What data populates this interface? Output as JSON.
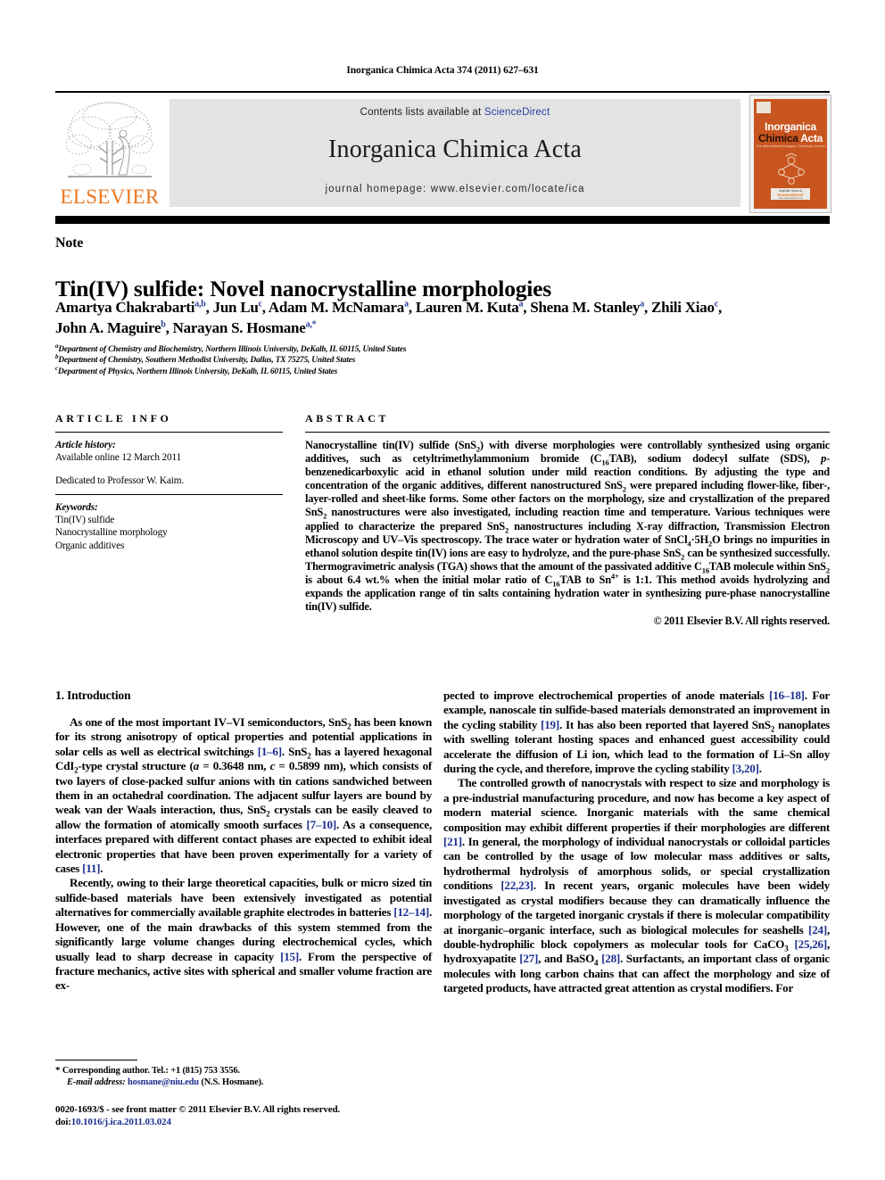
{
  "running_head": "Inorganica Chimica Acta 374 (2011) 627–631",
  "masthead": {
    "contents_prefix": "Contents lists available at ",
    "sciencedirect": "ScienceDirect",
    "journal_title": "Inorganica Chimica Acta",
    "homepage": "journal homepage: www.elsevier.com/locate/ica",
    "publisher_wordmark": "ELSEVIER",
    "cover": {
      "line1": "Inorganica",
      "line2_dark": "Chimica",
      "line2_light": "Acta",
      "tagline": "The International Inorganic Chemistry Journal",
      "sd_available": "Available online at",
      "sd_name": "ScienceDirect",
      "sd_url": "www.sciencedirect.com"
    },
    "accent_orange": "#E87722",
    "link_blue": "#2b3f9e",
    "band_grey": "#e3e3e3",
    "cover_orange": "#C8551F"
  },
  "article": {
    "type": "Note",
    "title": "Tin(IV) sulfide: Novel nanocrystalline morphologies",
    "authors_line1": "Amartya Chakrabarti",
    "authors": [
      {
        "name": "Amartya Chakrabarti",
        "sup": "a,b"
      },
      {
        "name": "Jun Lu",
        "sup": "c"
      },
      {
        "name": "Adam M. McNamara",
        "sup": "a"
      },
      {
        "name": "Lauren M. Kuta",
        "sup": "a"
      },
      {
        "name": "Shena M. Stanley",
        "sup": "a"
      },
      {
        "name": "Zhili Xiao",
        "sup": "c"
      },
      {
        "name": "John A. Maguire",
        "sup": "b"
      },
      {
        "name": "Narayan S. Hosmane",
        "sup": "a,*"
      }
    ],
    "affiliations": [
      {
        "mark": "a",
        "text": "Department of Chemistry and Biochemistry, Northern Illinois University, DeKalb, IL 60115, United States"
      },
      {
        "mark": "b",
        "text": "Department of Chemistry, Southern Methodist University, Dallas, TX 75275, United States"
      },
      {
        "mark": "c",
        "text": "Department of Physics, Northern Illinois University, DeKalb, IL 60115, United States"
      }
    ]
  },
  "article_info": {
    "heading": "ARTICLE INFO",
    "history_label": "Article history:",
    "history_value": "Available online 12 March 2011",
    "dedication": "Dedicated to Professor W. Kaim.",
    "keywords_label": "Keywords:",
    "keywords": [
      "Tin(IV) sulfide",
      "Nanocrystalline morphology",
      "Organic additives"
    ]
  },
  "abstract": {
    "heading": "ABSTRACT",
    "copyright": "© 2011 Elsevier B.V. All rights reserved."
  },
  "sections": {
    "intro_heading": "1. Introduction"
  },
  "footnotes": {
    "corresponding_star": "*",
    "corresponding": "Corresponding author. Tel.: +1 (815) 753 3556.",
    "email_label": "E-mail address:",
    "email": "hosmane@niu.edu",
    "email_owner": "(N.S. Hosmane).",
    "issn_line": "0020-1693/$ - see front matter © 2011 Elsevier B.V. All rights reserved.",
    "doi_label": "doi:",
    "doi": "10.1016/j.ica.2011.03.024"
  }
}
